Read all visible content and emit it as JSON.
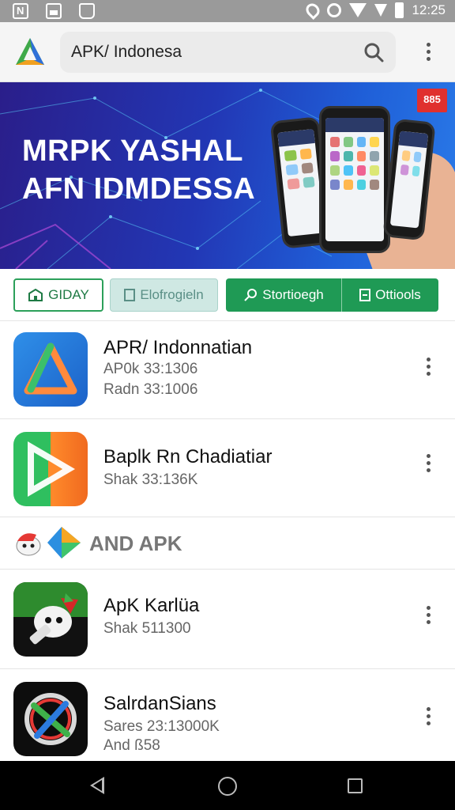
{
  "status_bar": {
    "time": "12:25",
    "left_icons": [
      "notification-n-icon",
      "image-icon",
      "bag-icon"
    ],
    "right_icons": [
      "location-icon",
      "alarm-icon",
      "wifi-icon",
      "signal-icon",
      "battery-icon"
    ]
  },
  "app_bar": {
    "search_value": "APK/ Indonesa",
    "icons": [
      "app-logo-icon",
      "search-icon",
      "more-vert-icon"
    ]
  },
  "banner": {
    "line1": "MRPK YASHAL",
    "line2": "AFN IDMDESSA",
    "corner_badge": "885"
  },
  "chips": [
    {
      "label": "GIDAY",
      "icon": "store-icon",
      "style": "outlined"
    },
    {
      "label": "Elofrogieln",
      "icon": "image-icon",
      "style": "muted"
    },
    {
      "label": "Stortioegh",
      "icon": "search-icon",
      "style": "filled"
    },
    {
      "label": "Ottiools",
      "icon": "doc-icon",
      "style": "filled"
    }
  ],
  "list": [
    {
      "title": "APR/ Indonnatian",
      "lines": [
        "AP0k 33:1306",
        "Radn 33:1006"
      ],
      "icon": "blue-triangle-app-icon"
    },
    {
      "title": "Baplk Rn Chadiatiar",
      "lines": [
        "Shak 33:136K"
      ],
      "icon": "play-arrow-app-icon"
    }
  ],
  "section": {
    "label": "AND APK",
    "icons": [
      "mascot-icon",
      "prism-icon"
    ]
  },
  "list2": [
    {
      "title": "ApK Karlüa",
      "lines": [
        "Shak 511300"
      ],
      "icon": "rocket-mascot-app-icon"
    },
    {
      "title": "SalrdanSians",
      "lines": [
        "Sares 23:13000K",
        "And ß58"
      ],
      "icon": "circle-x-app-icon"
    }
  ],
  "colors": {
    "accent_green": "#1f9a55",
    "banner_blue": "#2237b5",
    "badge_red": "#e0302e"
  }
}
